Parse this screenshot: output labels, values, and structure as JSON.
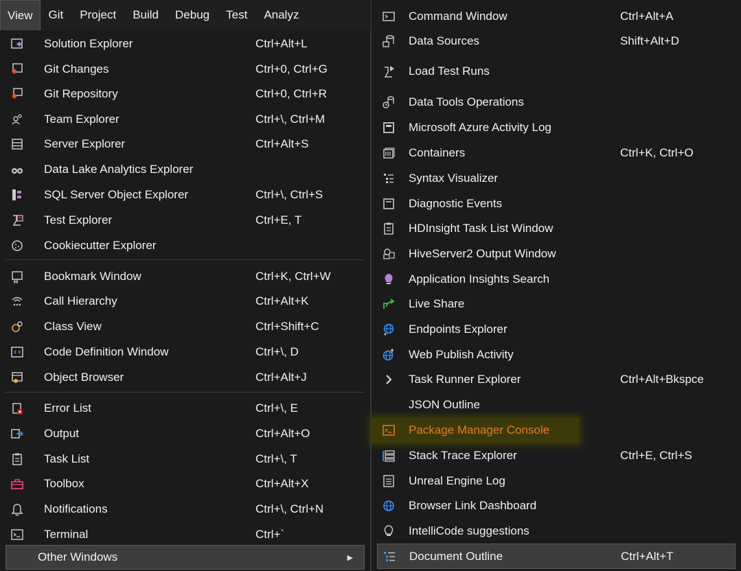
{
  "menubar": {
    "items": [
      "View",
      "Git",
      "Project",
      "Build",
      "Debug",
      "Test",
      "Analyz"
    ]
  },
  "view_menu": {
    "items": [
      {
        "label": "Solution Explorer",
        "shortcut": "Ctrl+Alt+L",
        "icon": "solution-explorer-icon"
      },
      {
        "label": "Git Changes",
        "shortcut": "Ctrl+0, Ctrl+G",
        "icon": "git-changes-icon"
      },
      {
        "label": "Git Repository",
        "shortcut": "Ctrl+0, Ctrl+R",
        "icon": "git-repository-icon"
      },
      {
        "label": "Team Explorer",
        "shortcut": "Ctrl+\\, Ctrl+M",
        "icon": "team-explorer-icon"
      },
      {
        "label": "Server Explorer",
        "shortcut": "Ctrl+Alt+S",
        "icon": "server-explorer-icon"
      },
      {
        "label": "Data Lake Analytics Explorer",
        "shortcut": "",
        "icon": "binoculars-icon"
      },
      {
        "label": "SQL Server Object Explorer",
        "shortcut": "Ctrl+\\, Ctrl+S",
        "icon": "sql-server-icon"
      },
      {
        "label": "Test Explorer",
        "shortcut": "Ctrl+E, T",
        "icon": "test-explorer-icon"
      },
      {
        "label": "Cookiecutter Explorer",
        "shortcut": "",
        "icon": "cookie-icon"
      },
      {
        "label": "Bookmark Window",
        "shortcut": "Ctrl+K, Ctrl+W",
        "icon": "bookmark-icon"
      },
      {
        "label": "Call Hierarchy",
        "shortcut": "Ctrl+Alt+K",
        "icon": "call-hierarchy-icon"
      },
      {
        "label": "Class View",
        "shortcut": "Ctrl+Shift+C",
        "icon": "class-view-icon"
      },
      {
        "label": "Code Definition Window",
        "shortcut": "Ctrl+\\, D",
        "icon": "code-definition-icon"
      },
      {
        "label": "Object Browser",
        "shortcut": "Ctrl+Alt+J",
        "icon": "object-browser-icon"
      },
      {
        "label": "Error List",
        "shortcut": "Ctrl+\\, E",
        "icon": "error-list-icon"
      },
      {
        "label": "Output",
        "shortcut": "Ctrl+Alt+O",
        "icon": "output-icon"
      },
      {
        "label": "Task List",
        "shortcut": "Ctrl+\\, T",
        "icon": "task-list-icon"
      },
      {
        "label": "Toolbox",
        "shortcut": "Ctrl+Alt+X",
        "icon": "toolbox-icon"
      },
      {
        "label": "Notifications",
        "shortcut": "Ctrl+\\, Ctrl+N",
        "icon": "bell-icon"
      },
      {
        "label": "Terminal",
        "shortcut": "Ctrl+`",
        "icon": "terminal-icon"
      },
      {
        "label": "Other Windows",
        "shortcut": "",
        "icon": ""
      }
    ]
  },
  "other_windows": {
    "items": [
      {
        "label": "Command Window",
        "shortcut": "Ctrl+Alt+A",
        "icon": "command-window-icon"
      },
      {
        "label": "Data Sources",
        "shortcut": "Shift+Alt+D",
        "icon": "data-sources-icon"
      },
      {
        "label": "Load Test Runs",
        "shortcut": "",
        "icon": "load-test-icon"
      },
      {
        "label": "Data Tools Operations",
        "shortcut": "",
        "icon": "data-tools-icon"
      },
      {
        "label": "Microsoft Azure Activity Log",
        "shortcut": "",
        "icon": "activity-log-icon"
      },
      {
        "label": "Containers",
        "shortcut": "Ctrl+K, Ctrl+O",
        "icon": "containers-icon"
      },
      {
        "label": "Syntax Visualizer",
        "shortcut": "",
        "icon": "syntax-visualizer-icon"
      },
      {
        "label": "Diagnostic Events",
        "shortcut": "",
        "icon": "diagnostic-events-icon"
      },
      {
        "label": "HDInsight Task List Window",
        "shortcut": "",
        "icon": "hdinsight-icon"
      },
      {
        "label": "HiveServer2 Output Window",
        "shortcut": "",
        "icon": "hiveserver-icon"
      },
      {
        "label": "Application Insights Search",
        "shortcut": "",
        "icon": "lightbulb-icon"
      },
      {
        "label": "Live Share",
        "shortcut": "",
        "icon": "live-share-icon"
      },
      {
        "label": "Endpoints Explorer",
        "shortcut": "",
        "icon": "globe-icon"
      },
      {
        "label": "Web Publish Activity",
        "shortcut": "",
        "icon": "web-publish-icon"
      },
      {
        "label": "Task Runner Explorer",
        "shortcut": "Ctrl+Alt+Bkspce",
        "icon": "chevron-right-icon"
      },
      {
        "label": "JSON Outline",
        "shortcut": "",
        "icon": ""
      },
      {
        "label": "Package Manager Console",
        "shortcut": "",
        "icon": "package-console-icon"
      },
      {
        "label": "Stack Trace Explorer",
        "shortcut": "Ctrl+E, Ctrl+S",
        "icon": "stack-trace-icon"
      },
      {
        "label": "Unreal Engine Log",
        "shortcut": "",
        "icon": "unreal-log-icon"
      },
      {
        "label": "Browser Link Dashboard",
        "shortcut": "",
        "icon": "browser-link-icon"
      },
      {
        "label": "IntelliCode suggestions",
        "shortcut": "",
        "icon": "intellicode-icon"
      },
      {
        "label": "Document Outline",
        "shortcut": "Ctrl+Alt+T",
        "icon": "document-outline-icon"
      }
    ]
  },
  "colors": {
    "highlight_text": "#e07b2a",
    "highlight_bg": "#3c3a0a",
    "menu_bg": "#1b1b1b"
  }
}
